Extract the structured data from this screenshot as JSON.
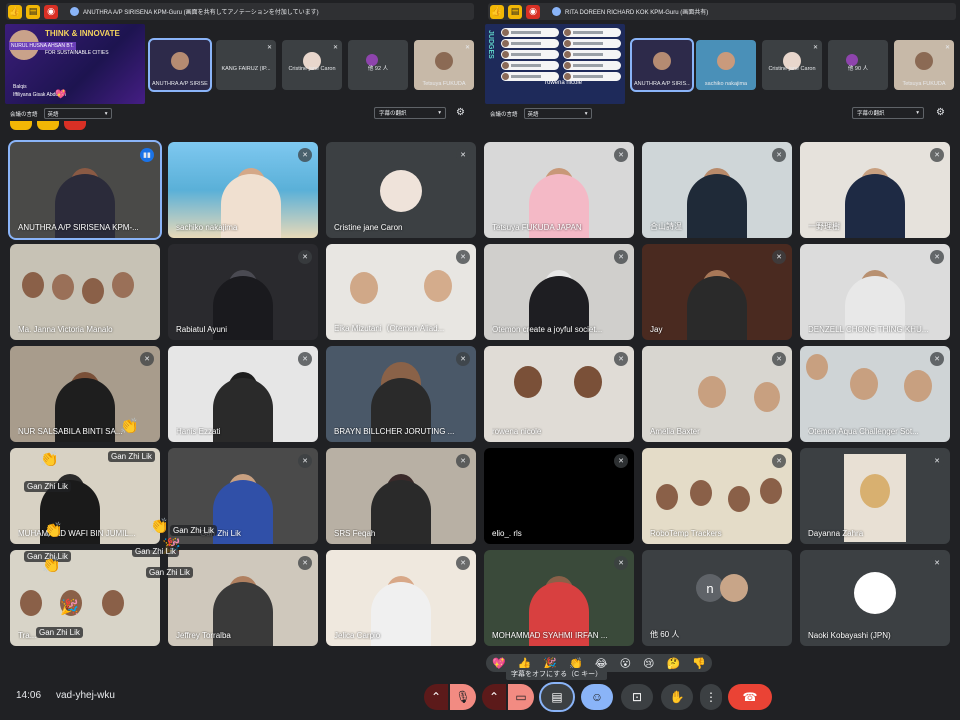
{
  "top_left": {
    "title": "ANUTHRA A/P SIRISENA KPM-Guru (画面を共有してアノテーションを付加しています)",
    "presentation": {
      "heading": "THINK & INNOVATE",
      "subtitle": "FOR SUSTAINABLE CITIES",
      "banner": "NURUL HUSNA AHSAN BT.",
      "name1": "Balqis",
      "name2": "Iffiliyana Gisak Abdullah"
    },
    "thumbs": [
      {
        "name": "ANUTHRA A/P SIRISENA KPM-Guru",
        "active": true
      },
      {
        "name": "KANG FAIRUZ (IP..."
      },
      {
        "name": "Cristine jane Caron"
      },
      {
        "name": "他 92 人"
      },
      {
        "name": "Tetsuya FUKUDA"
      }
    ],
    "lang_label": "会議の言語",
    "lang_value": "英語",
    "translate_value": "字幕の翻訳"
  },
  "top_right": {
    "title": "RITA DOREEN RICHARD KOK KPM-Guru (画面共有)",
    "presentation": {
      "side_label": "JUDGES",
      "name": "rowena nicole"
    },
    "thumbs": [
      {
        "name": "ANUTHRA A/P SIRIS...",
        "active": true
      },
      {
        "name": "sachiko nakajima"
      },
      {
        "name": "Cristine jane Caron"
      },
      {
        "name": "他 90 人"
      },
      {
        "name": "Tetsuya FUKUDA"
      }
    ],
    "lang_label": "会議の言語",
    "lang_value": "英語",
    "translate_value": "字幕の翻訳"
  },
  "tiles": [
    {
      "name": "ANUTHRA A/P SIRISENA KPM-...",
      "speaking": true
    },
    {
      "name": "sachiko nakajima"
    },
    {
      "name": "Cristine jane Caron"
    },
    {
      "name": "Tetsuya FUKUDA JAPAN"
    },
    {
      "name": "合山詩温"
    },
    {
      "name": "一野理樹"
    },
    {
      "name": "Ma. Janna Victoria Manalo"
    },
    {
      "name": "Rabiatul Ayuni"
    },
    {
      "name": "Eika Mizutani（Otemon Aliad..."
    },
    {
      "name": "Otemon create a joyful societ..."
    },
    {
      "name": "Jay"
    },
    {
      "name": "DENZELL CHONG THING KHU..."
    },
    {
      "name": "NUR SALSABILA BINTI SA..."
    },
    {
      "name": "Hanis Ezzati"
    },
    {
      "name": "BRAYN BILLCHER JORUTING ..."
    },
    {
      "name": "rowena nicole"
    },
    {
      "name": "Amelia Baxter"
    },
    {
      "name": "Otemon Aqua Challenger Sot..."
    },
    {
      "name": "MUHAMMAD WAFI BIN JUMIL..."
    },
    {
      "name": "Gan Zhi Lik"
    },
    {
      "name": "SRS Feqah"
    },
    {
      "name": "elio_. rls"
    },
    {
      "name": "RoboTemp Trackers"
    },
    {
      "name": "Dayanna Zahra"
    },
    {
      "name": "Tra..."
    },
    {
      "name": "Jeffrey Torralba"
    },
    {
      "name": "Jelica Carpio"
    },
    {
      "name": "MOHAMMAD SYAHMI IRFAN ..."
    },
    {
      "name": "他 60 人",
      "avatar_letter": "n"
    },
    {
      "name": "Naoki Kobayashi (JPN)"
    }
  ],
  "reaction_label": "Gan Zhi Lik",
  "reactions": [
    "💖",
    "👍",
    "🎉",
    "👏",
    "😂",
    "😮",
    "😢",
    "🤔",
    "👎"
  ],
  "tooltip": "字幕をオフにする（C キー）",
  "clock": "14:06",
  "meeting_code": "vad-yhej-wku"
}
